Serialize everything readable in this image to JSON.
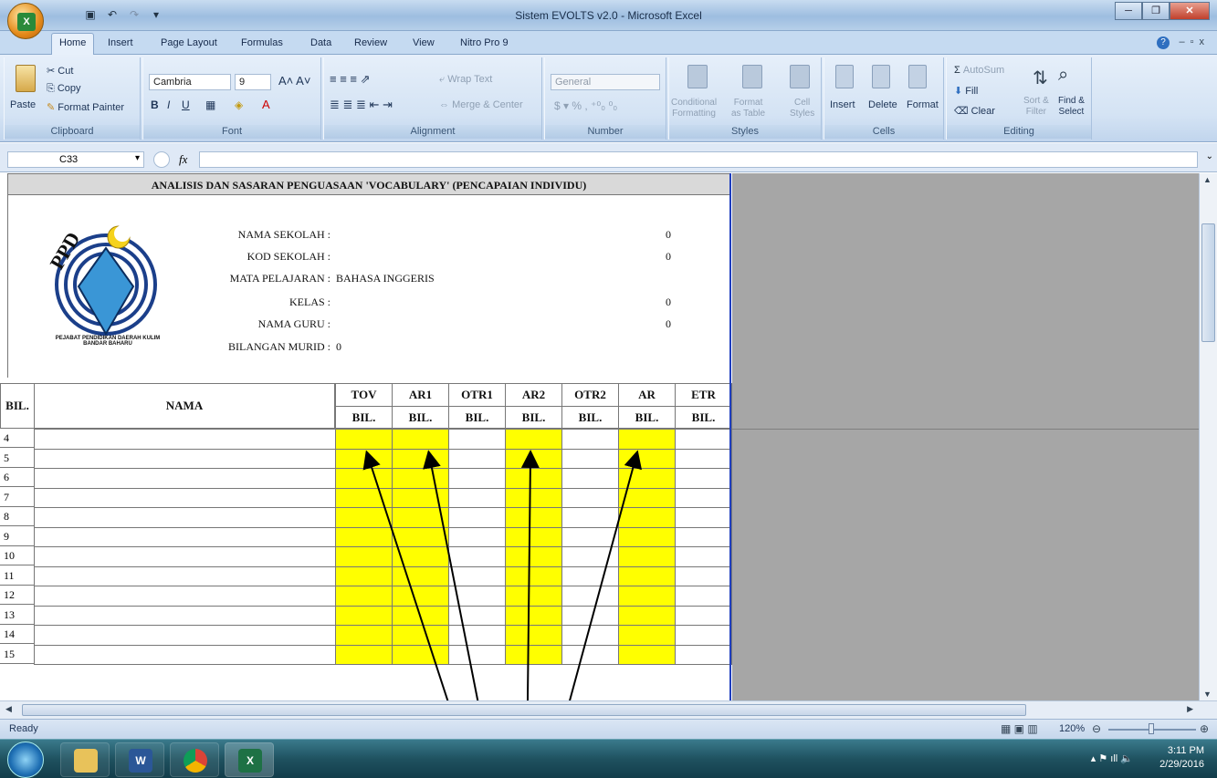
{
  "window": {
    "title": "Sistem EVOLTS v2.0 - Microsoft Excel"
  },
  "tabs": [
    "Home",
    "Insert",
    "Page Layout",
    "Formulas",
    "Data",
    "Review",
    "View",
    "Nitro Pro 9"
  ],
  "ribbon": {
    "clipboard": {
      "paste": "Paste",
      "cut": "Cut",
      "copy": "Copy",
      "format_painter": "Format Painter",
      "caption": "Clipboard"
    },
    "font": {
      "name": "Cambria",
      "size": "9",
      "caption": "Font"
    },
    "alignment": {
      "wrap": "Wrap Text",
      "merge": "Merge & Center",
      "caption": "Alignment"
    },
    "number": {
      "format": "General",
      "caption": "Number"
    },
    "styles": {
      "conditional": "Conditional\nFormatting",
      "format_table": "Format\nas Table",
      "cell_styles": "Cell\nStyles",
      "caption": "Styles"
    },
    "cells": {
      "insert": "Insert",
      "delete": "Delete",
      "format": "Format",
      "caption": "Cells"
    },
    "editing": {
      "autosum": "AutoSum",
      "fill": "Fill",
      "clear": "Clear",
      "sort": "Sort &\nFilter",
      "find": "Find &\nSelect",
      "caption": "Editing"
    }
  },
  "formula_bar": {
    "name_box": "C33",
    "fx": "fx",
    "value": ""
  },
  "sheet": {
    "title": "ANALISIS DAN SASARAN PENGUASAAN 'VOCABULARY' (PENCAPAIAN INDIVIDU)",
    "logo_text": "PPD",
    "logo_ring_text": "PEJABAT PENDIDIKAN DAERAH KULIM BANDAR BAHARU",
    "info": [
      {
        "label": "NAMA SEKOLAH :",
        "value": "0"
      },
      {
        "label": "KOD SEKOLAH :",
        "value": "0"
      },
      {
        "label": "MATA PELAJARAN :",
        "value": "BAHASA INGGERIS"
      },
      {
        "label": "KELAS :",
        "value": "0"
      },
      {
        "label": "NAMA GURU :",
        "value": "0"
      },
      {
        "label": "BILANGAN MURID :",
        "value": "0"
      }
    ],
    "col_bil": "BIL.",
    "col_nama": "NAMA",
    "columns": [
      "TOV",
      "AR1",
      "OTR1",
      "AR2",
      "OTR2",
      "AR",
      "ETR"
    ],
    "subheader": "BIL.",
    "highlight_columns": [
      "TOV",
      "AR1",
      "AR2",
      "AR"
    ],
    "highlight_color": "#ffff00",
    "row_numbers": [
      "4",
      "5",
      "6",
      "7",
      "8",
      "9",
      "10",
      "11",
      "12",
      "13",
      "14",
      "15"
    ]
  },
  "status": {
    "ready": "Ready",
    "zoom": "120%"
  },
  "taskbar": {
    "time": "3:11 PM",
    "date": "2/29/2016"
  }
}
